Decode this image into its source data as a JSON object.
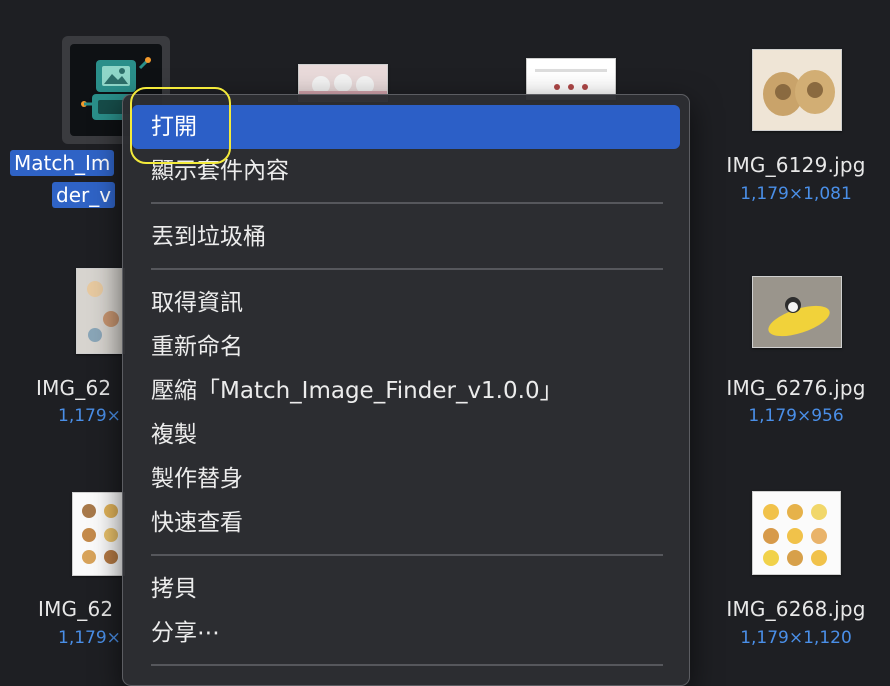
{
  "selected_item": {
    "name_line1": "Match_Im",
    "name_line2": "der_v"
  },
  "files": [
    {
      "name": "IMG_6129.jpg",
      "dims": "1,179×1,081"
    },
    {
      "name": "IMG_6276.jpg",
      "dims": "1,179×956"
    },
    {
      "name": "IMG_6268.jpg",
      "dims": "1,179×1,120"
    },
    {
      "name": "IMG_62",
      "dims": "1,179×"
    },
    {
      "name": "IMG_62",
      "dims": "1,179×"
    }
  ],
  "context_menu": {
    "items": [
      "打開",
      "顯示套件內容",
      "丟到垃圾桶",
      "取得資訊",
      "重新命名",
      "壓縮「Match_Image_Finder_v1.0.0」",
      "複製",
      "製作替身",
      "快速查看",
      "拷貝",
      "分享⋯"
    ]
  },
  "colors": {
    "background": "#1e1f23",
    "menu_background": "#2c2d32",
    "selection_blue": "#2c5fc7",
    "dimension_text": "#4a8fe8",
    "highlight_ring": "#f3ea3b"
  }
}
